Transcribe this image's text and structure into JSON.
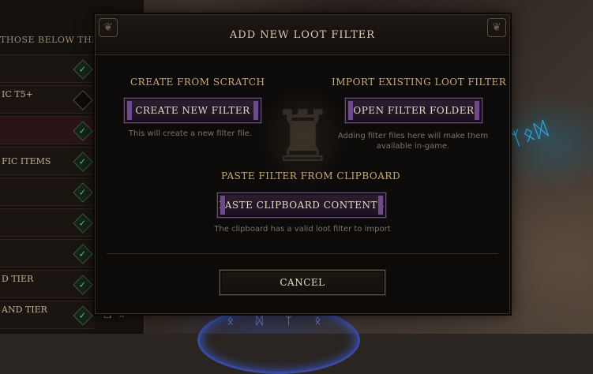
{
  "left_panel": {
    "header": "THOSE BELOW THEM",
    "rows": [
      {
        "label": "",
        "state": "check"
      },
      {
        "label": "IC T5+",
        "state": "off"
      },
      {
        "label": "",
        "state": "check"
      },
      {
        "label": "FIC ITEMS",
        "state": "check"
      },
      {
        "label": "",
        "state": "check"
      },
      {
        "label": "",
        "state": "check"
      },
      {
        "label": "",
        "state": "check"
      },
      {
        "label": "D TIER",
        "state": "check"
      },
      {
        "label": "AND TIER",
        "state": "check"
      }
    ]
  },
  "dialog": {
    "title": "ADD NEW LOOT FILTER",
    "scratch": {
      "title": "CREATE FROM SCRATCH",
      "button": "CREATE NEW FILTER",
      "hint": "This will create a new filter file."
    },
    "import": {
      "title": "IMPORT EXISTING LOOT FILTER",
      "button": "OPEN FILTER FOLDER",
      "hint": "Adding filter files here will make them available in-game."
    },
    "paste": {
      "title": "PASTE FILTER FROM CLIPBOARD",
      "button": "PASTE CLIPBOARD CONTENTS",
      "hint": "The clipboard has a valid loot filter to import"
    },
    "cancel": "CANCEL"
  },
  "icons": {
    "check": "✓",
    "copy": "copy-icon",
    "close": "close-icon"
  },
  "colors": {
    "accent_purple": "#6f4a8a",
    "section_gold": "#c9aa74",
    "check_green": "#64d26a"
  }
}
